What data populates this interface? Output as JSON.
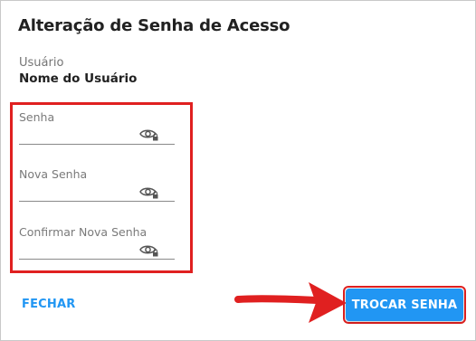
{
  "dialog": {
    "title": "Alteração de Senha de Acesso",
    "user_label": "Usuário",
    "user_name": "Nome do Usuário"
  },
  "fields": [
    {
      "label": "Senha",
      "value": "",
      "icon": "eye-lock-icon"
    },
    {
      "label": "Nova Senha",
      "value": "",
      "icon": "eye-lock-icon"
    },
    {
      "label": "Confirmar Nova Senha",
      "value": "",
      "icon": "eye-lock-icon"
    }
  ],
  "actions": {
    "close_label": "FECHAR",
    "submit_label": "TROCAR SENHA"
  },
  "colors": {
    "accent": "#2196f3",
    "annotation": "#e02020"
  }
}
